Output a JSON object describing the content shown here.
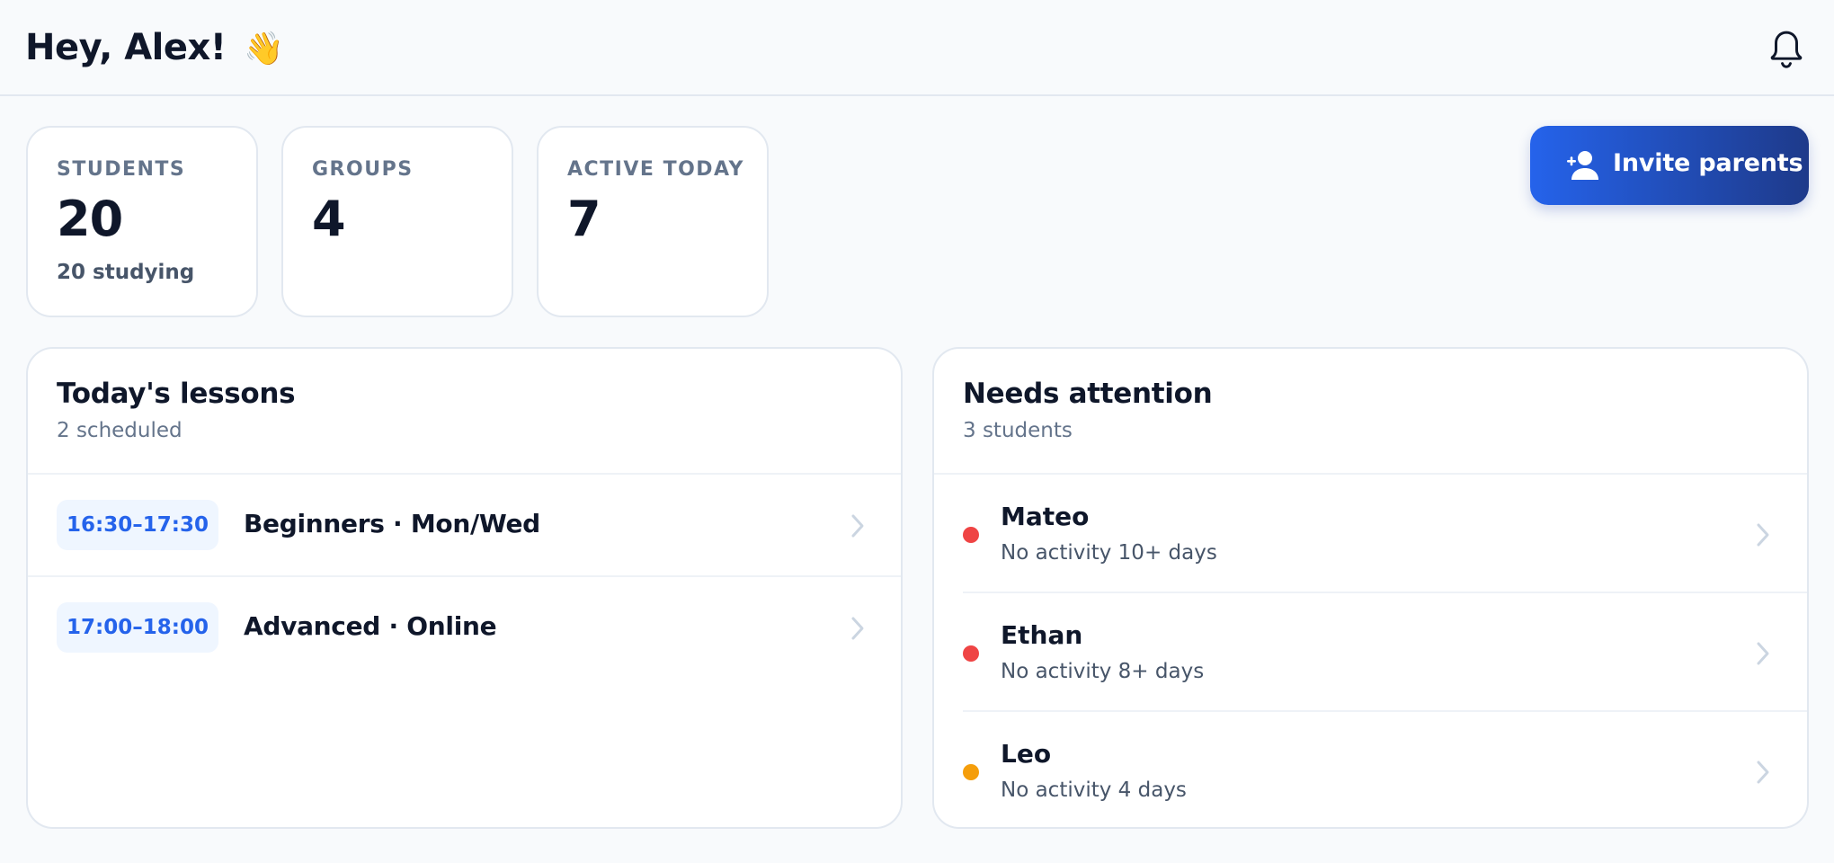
{
  "header": {
    "greeting": "Hey, Alex!",
    "greeting_emoji": "👋",
    "bell_icon": "bell-icon"
  },
  "stats": [
    {
      "label": "STUDENTS",
      "value": "20",
      "sub": "20 studying"
    },
    {
      "label": "GROUPS",
      "value": "4",
      "sub": ""
    },
    {
      "label": "ACTIVE TODAY",
      "value": "7",
      "sub": ""
    }
  ],
  "invite_button": {
    "label": "Invite parents",
    "icon": "add-user-icon"
  },
  "lessons_panel": {
    "title": "Today's lessons",
    "subtitle": "2 scheduled",
    "items": [
      {
        "time": "16:30–17:30",
        "name": "Beginners · Mon/Wed"
      },
      {
        "time": "17:00–18:00",
        "name": "Advanced · Online"
      }
    ]
  },
  "attention_panel": {
    "title": "Needs attention",
    "subtitle": "3 students",
    "items": [
      {
        "name": "Mateo",
        "note": "No activity 10+ days",
        "status": "red"
      },
      {
        "name": "Ethan",
        "note": "No activity 8+ days",
        "status": "red"
      },
      {
        "name": "Leo",
        "note": "No activity 4 days",
        "status": "orange"
      }
    ]
  },
  "colors": {
    "accent": "#2563eb",
    "accent_dark": "#1e3a8a",
    "status_red": "#ef4444",
    "status_orange": "#f59e0b",
    "chevron": "#cbd5e1"
  }
}
